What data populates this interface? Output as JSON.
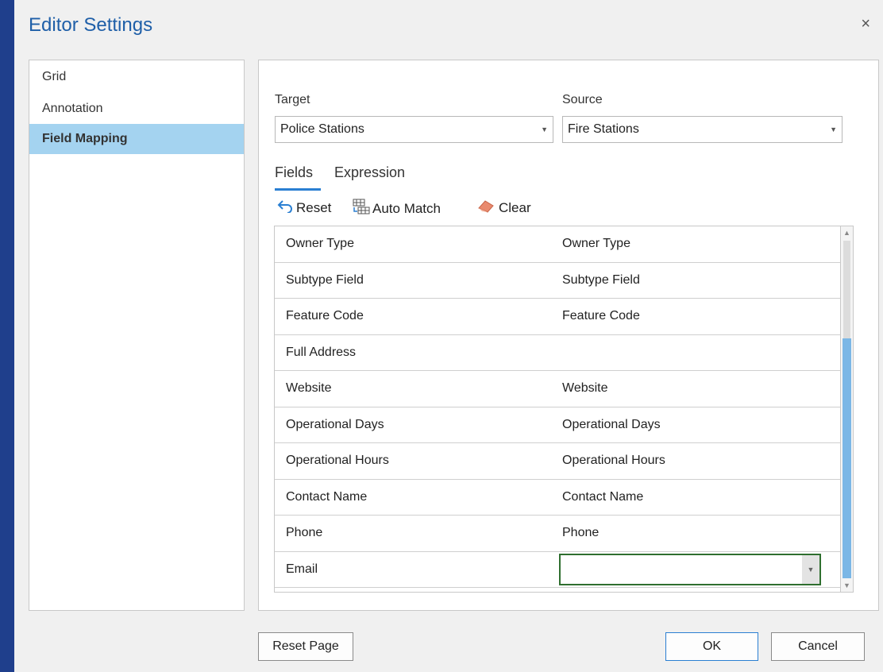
{
  "dialog": {
    "title": "Editor Settings",
    "close_glyph": "×"
  },
  "nav": {
    "items": [
      {
        "label": "Grid",
        "selected": false
      },
      {
        "label": "Annotation",
        "selected": false
      },
      {
        "label": "Field Mapping",
        "selected": true
      }
    ]
  },
  "mapping": {
    "target_label": "Target",
    "target_value": "Police Stations",
    "source_label": "Source",
    "source_value": "Fire Stations",
    "tabs": [
      {
        "label": "Fields",
        "active": true
      },
      {
        "label": "Expression",
        "active": false
      }
    ],
    "toolbar": {
      "reset_label": "Reset",
      "auto_match_label": "Auto Match",
      "clear_label": "Clear"
    },
    "rows": [
      {
        "target": "Owner Type",
        "source": "Owner Type"
      },
      {
        "target": "Subtype Field",
        "source": "Subtype Field"
      },
      {
        "target": "Feature Code",
        "source": "Feature Code"
      },
      {
        "target": "Full Address",
        "source": ""
      },
      {
        "target": "Website",
        "source": "Website"
      },
      {
        "target": "Operational Days",
        "source": "Operational Days"
      },
      {
        "target": "Operational Hours",
        "source": "Operational Hours"
      },
      {
        "target": "Contact Name",
        "source": "Contact Name"
      },
      {
        "target": "Phone",
        "source": "Phone"
      },
      {
        "target": "Email",
        "source": ""
      }
    ]
  },
  "buttons": {
    "reset_page": "Reset Page",
    "ok": "OK",
    "cancel": "Cancel"
  },
  "colors": {
    "accent": "#2a7fd2",
    "selected_nav": "#a4d3f0",
    "title": "#1f5fa8",
    "active_cell_border": "#2f6f2f"
  },
  "icons": {
    "reset": "undo-arrow-icon",
    "auto_match": "auto-match-grid-icon",
    "clear": "eraser-icon",
    "dropdown": "chevron-down-icon"
  }
}
